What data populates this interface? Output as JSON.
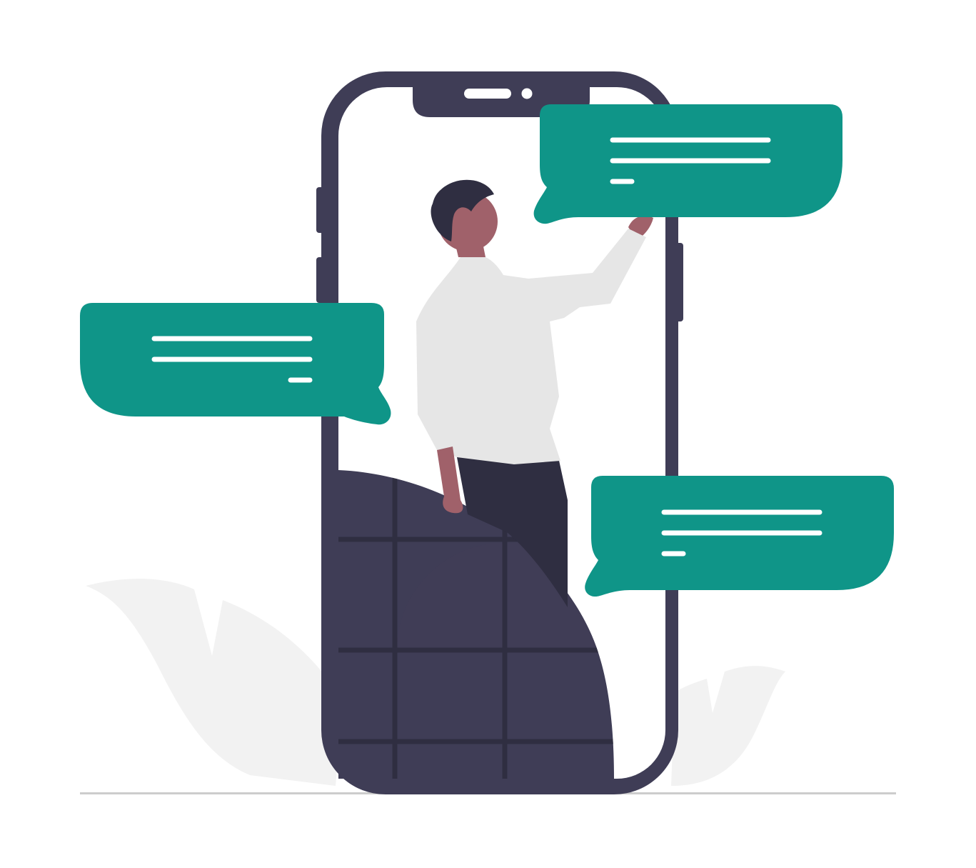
{
  "illustration": {
    "subject": "person-with-phone-and-chat-bubbles",
    "colors": {
      "background": "#ffffff",
      "accent": "#0f9588",
      "phone_frame": "#3f3d56",
      "phone_screen": "#ffffff",
      "phone_pattern_lines": "#2f2e41",
      "leaf": "#f2f2f2",
      "ground_line": "#cccccc",
      "skin": "#a0616a",
      "hair": "#2f2e41",
      "shirt": "#e6e6e6",
      "pants": "#2f2e41",
      "bubble_text_lines": "#ffffff"
    },
    "chat_bubbles": [
      {
        "name": "chat-bubble-top-right",
        "tail": "left",
        "lines": 3
      },
      {
        "name": "chat-bubble-left",
        "tail": "right",
        "lines": 3
      },
      {
        "name": "chat-bubble-bottom-right",
        "tail": "left",
        "lines": 3
      }
    ]
  }
}
